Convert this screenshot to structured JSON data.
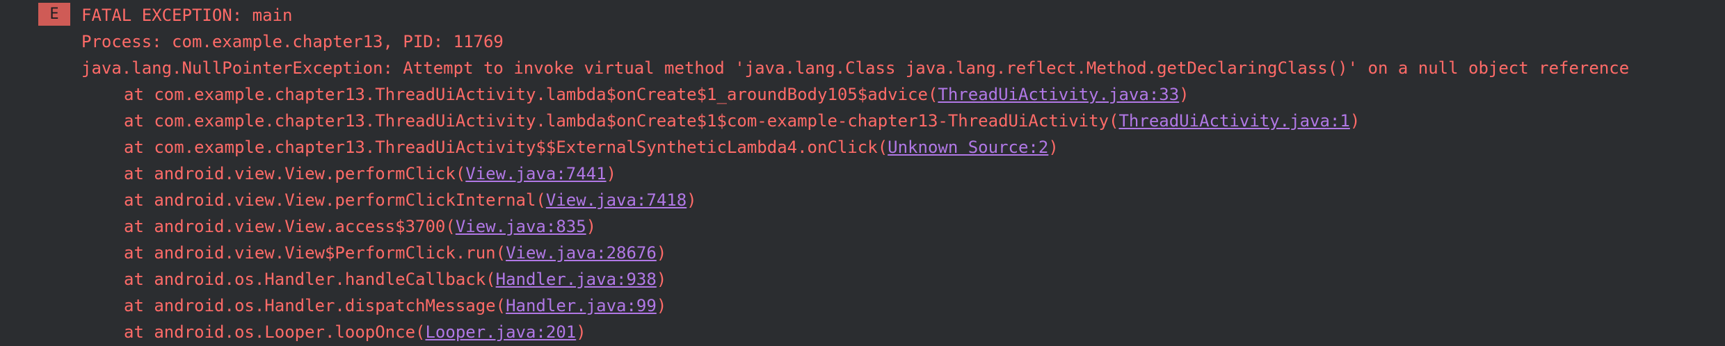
{
  "log": {
    "level_badge": "E",
    "header": "FATAL EXCEPTION: main",
    "process": "Process: com.example.chapter13, PID: 11769",
    "exception": "java.lang.NullPointerException: Attempt to invoke virtual method 'java.lang.Class java.lang.reflect.Method.getDeclaringClass()' on a null object reference",
    "frames": [
      {
        "prefix": "at com.example.chapter13.ThreadUiActivity.lambda$onCreate$1_aroundBody105$advice(",
        "link": "ThreadUiActivity.java:33",
        "suffix": ")"
      },
      {
        "prefix": "at com.example.chapter13.ThreadUiActivity.lambda$onCreate$1$com-example-chapter13-ThreadUiActivity(",
        "link": "ThreadUiActivity.java:1",
        "suffix": ")"
      },
      {
        "prefix": "at com.example.chapter13.ThreadUiActivity$$ExternalSyntheticLambda4.onClick(",
        "link": "Unknown Source:2",
        "suffix": ")"
      },
      {
        "prefix": "at android.view.View.performClick(",
        "link": "View.java:7441",
        "suffix": ")"
      },
      {
        "prefix": "at android.view.View.performClickInternal(",
        "link": "View.java:7418",
        "suffix": ")"
      },
      {
        "prefix": "at android.view.View.access$3700(",
        "link": "View.java:835",
        "suffix": ")"
      },
      {
        "prefix": "at android.view.View$PerformClick.run(",
        "link": "View.java:28676",
        "suffix": ")"
      },
      {
        "prefix": "at android.os.Handler.handleCallback(",
        "link": "Handler.java:938",
        "suffix": ")"
      },
      {
        "prefix": "at android.os.Handler.dispatchMessage(",
        "link": "Handler.java:99",
        "suffix": ")"
      },
      {
        "prefix": "at android.os.Looper.loopOnce(",
        "link": "Looper.java:201",
        "suffix": ")"
      }
    ]
  },
  "colors": {
    "background": "#2b2d30",
    "error_text": "#ff6b68",
    "link": "#b178e6",
    "badge_bg": "#cf5b56"
  }
}
